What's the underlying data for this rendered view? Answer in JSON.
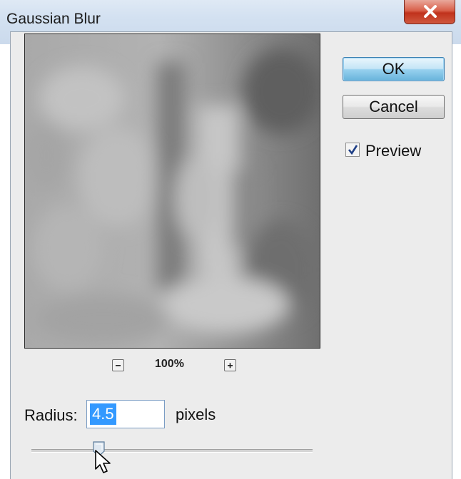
{
  "window": {
    "title": "Gaussian Blur",
    "close_icon": "close-icon"
  },
  "buttons": {
    "ok_label": "OK",
    "cancel_label": "Cancel"
  },
  "preview": {
    "label": "Preview",
    "checked": true
  },
  "zoom": {
    "level": "100%"
  },
  "radius": {
    "label": "Radius:",
    "value": "4.5",
    "unit": "pixels",
    "slider_fraction": 0.24
  },
  "colors": {
    "ok_accent": "#68b3db",
    "close_red": "#c0321c",
    "selection": "#3399ff"
  }
}
